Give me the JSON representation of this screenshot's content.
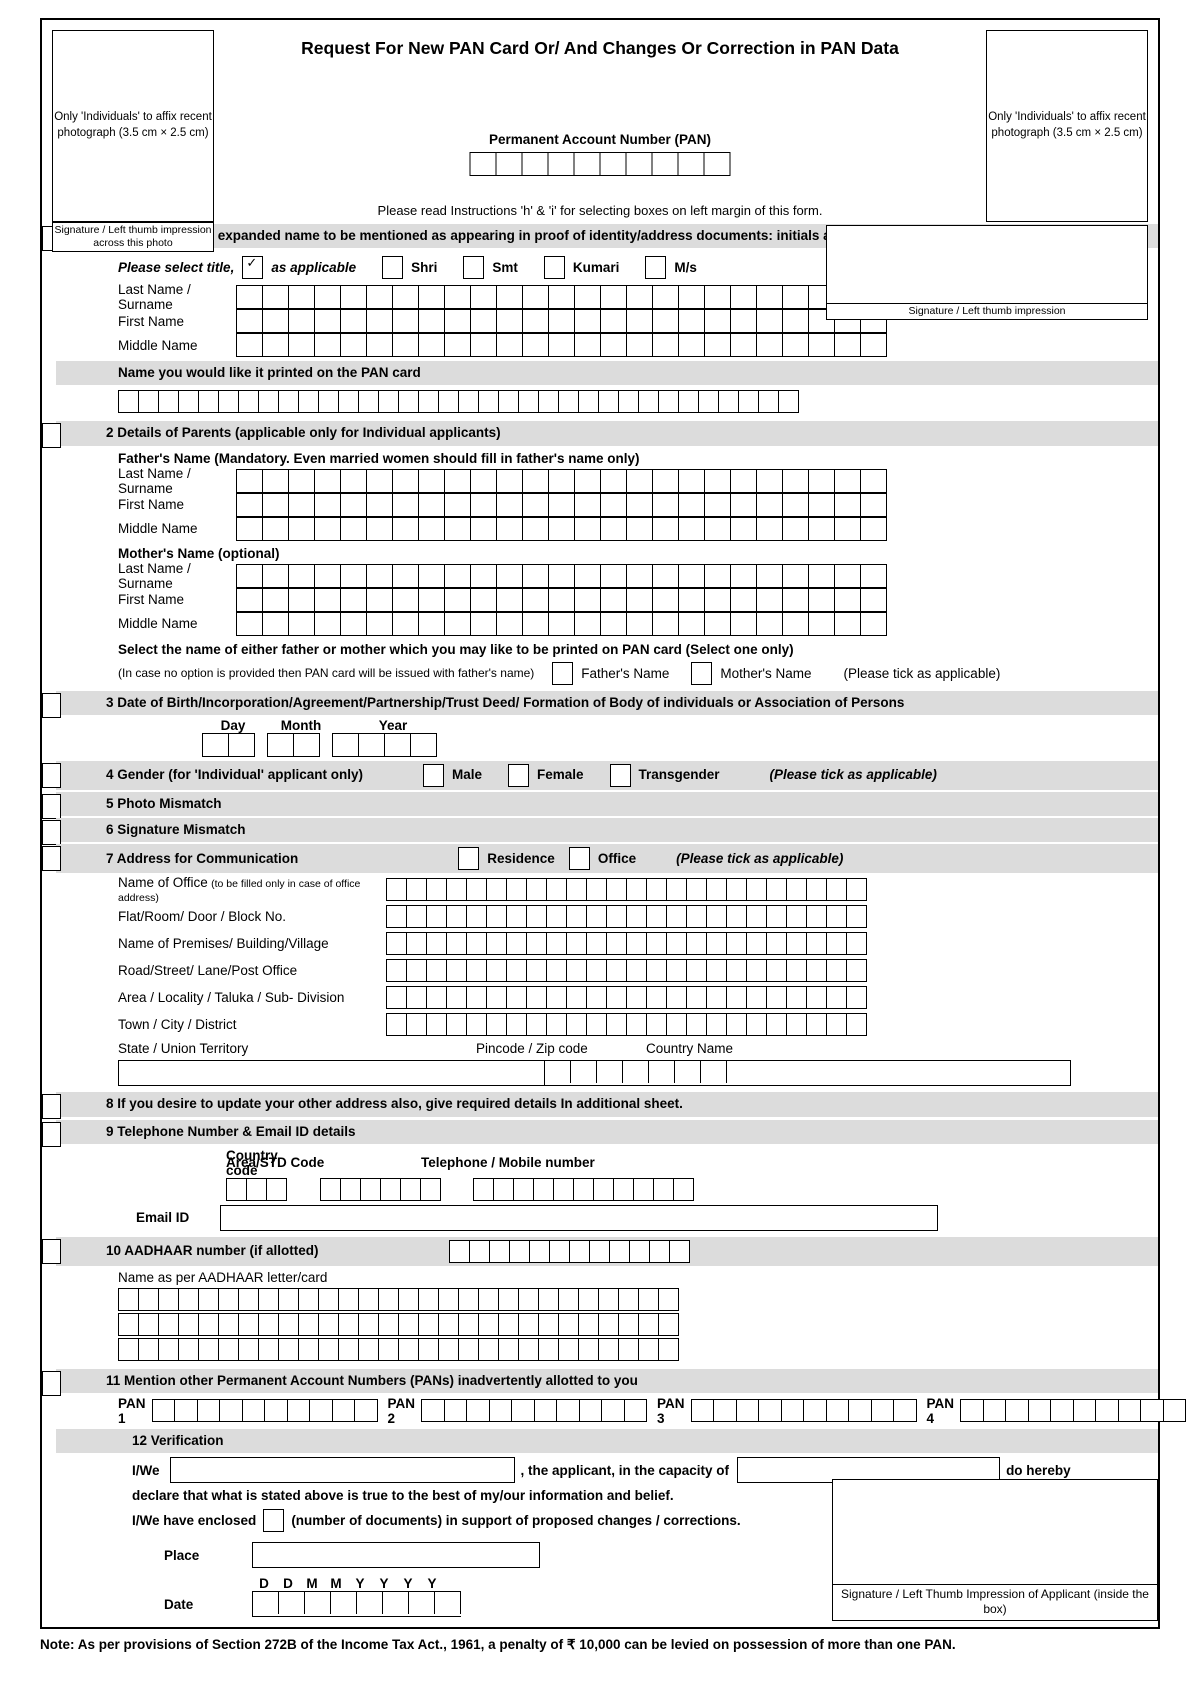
{
  "header": {
    "title": "Request For New PAN Card Or/ And Changes Or Correction in PAN Data",
    "photo_left": "Only 'Individuals' to affix recent photograph (3.5 cm × 2.5 cm)",
    "photo_right": "Only 'Individuals' to affix recent photograph (3.5 cm × 2.5 cm)",
    "sig_left_caption": "Signature / Left thumb impression across this photo",
    "sig_right_caption": "Signature / Left thumb impression",
    "pan_label": "Permanent Account Number (PAN)",
    "pan_boxes": 10,
    "pan_note": "Please read Instructions 'h' & 'i' for selecting boxes on left margin of this form."
  },
  "section1": {
    "bar": "1 Full Name (Full expanded name to be mentioned as appearing in proof of identity/address documents: initials are not permitted)",
    "title_prompt": "Please select title,",
    "title_suffix": "as applicable",
    "titles": [
      "Shri",
      "Smt",
      "Kumari",
      "M/s"
    ],
    "name_rows": [
      "Last Name / Surname",
      "First Name",
      "Middle Name"
    ],
    "name_boxes": 25,
    "printed_bar": "Name you would like it printed on the PAN card",
    "printed_boxes": 34
  },
  "section2": {
    "bar": "2 Details of Parents (applicable only for Individual applicants)",
    "father_heading": "Father's Name (Mandatory. Even married women should fill in father's name only)",
    "mother_heading": "Mother's Name (optional)",
    "name_rows": [
      "Last Name / Surname",
      "First Name",
      "Middle Name"
    ],
    "name_boxes": 25,
    "select_heading": "Select the name of either father or mother which you may like to be printed on PAN card (Select one only)",
    "select_note": "(In case no option is provided then PAN card will be issued with father's name)",
    "option_father": "Father's Name",
    "option_mother": "Mother's Name",
    "tick_note": "(Please tick as applicable)"
  },
  "section3": {
    "bar": "3 Date of Birth/Incorporation/Agreement/Partnership/Trust Deed/ Formation of Body of individuals or Association of Persons",
    "day_label": "Day",
    "month_label": "Month",
    "year_label": "Year",
    "day_boxes": 2,
    "month_boxes": 2,
    "year_boxes": 4
  },
  "section4": {
    "bar": "4  Gender (for 'Individual' applicant only)",
    "options": [
      "Male",
      "Female",
      "Transgender"
    ],
    "tick_note": "(Please tick as applicable)"
  },
  "section5": {
    "bar": "5  Photo Mismatch"
  },
  "section6": {
    "bar": "6  Signature Mismatch"
  },
  "section7": {
    "bar": "7 Address for Communication",
    "options": [
      "Residence",
      "Office"
    ],
    "tick_note": "(Please tick as applicable)",
    "rows": [
      {
        "label": "Name of Office",
        "sub": "(to be filled only in case of office address)",
        "boxes": 24
      },
      {
        "label": "Flat/Room/ Door / Block No.",
        "sub": "",
        "boxes": 24
      },
      {
        "label": "Name of Premises/ Building/Village",
        "sub": "",
        "boxes": 24
      },
      {
        "label": "Road/Street/ Lane/Post Office",
        "sub": "",
        "boxes": 24
      },
      {
        "label": "Area / Locality / Taluka / Sub- Division",
        "sub": "",
        "boxes": 24
      },
      {
        "label": "Town / City / District",
        "sub": "",
        "boxes": 24
      }
    ],
    "state_label": "State / Union Territory",
    "pincode_label": "Pincode / Zip code",
    "country_label": "Country Name",
    "pincode_boxes": 7
  },
  "section8": {
    "bar": "8 If you desire to update your other address also, give required details In additional sheet."
  },
  "section9": {
    "bar": "9 Telephone Number & Email ID details",
    "country_code_label": "Country code",
    "std_label": "Area/STD Code",
    "phone_label": "Telephone / Mobile number",
    "country_code_boxes": 3,
    "std_boxes": 6,
    "phone_boxes": 11,
    "email_label": "Email ID"
  },
  "section10": {
    "bar": "10 AADHAAR number (if allotted)",
    "aadhaar_boxes": 12,
    "name_label": "Name as per AADHAAR letter/card",
    "name_boxes": 28,
    "name_rows": 3
  },
  "section11": {
    "bar": "11 Mention other Permanent Account Numbers (PANs) inadvertently allotted to you",
    "pan_labels": [
      "PAN 1",
      "PAN 2",
      "PAN 3",
      "PAN 4"
    ],
    "pan_boxes": 10
  },
  "section12": {
    "bar": "12 Verification",
    "iwe_label": "I/We",
    "applicant_text": ", the applicant, in the capacity of",
    "hereby_text": "do  hereby",
    "declare_text": "declare that what is stated above is true to the best of my/our information and belief.",
    "enclosed_prefix": "I/We have enclosed",
    "enclosed_suffix": "(number of documents) in support of proposed changes / corrections.",
    "place_label": "Place",
    "date_label": "Date",
    "date_headers": [
      "D",
      "D",
      "M",
      "M",
      "Y",
      "Y",
      "Y",
      "Y"
    ],
    "sig_caption": "Signature / Left Thumb Impression of Applicant (inside the box)"
  },
  "footer": {
    "note": "Note: As per provisions of Section 272B of the Income Tax Act., 1961, a penalty of ₹ 10,000 can be levied on possession of more than one PAN."
  }
}
